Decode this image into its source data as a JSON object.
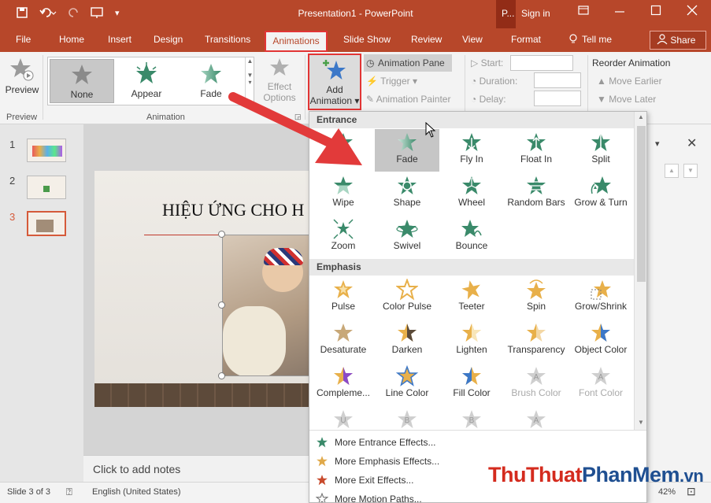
{
  "title_bar": {
    "document_title": "Presentation1 - PowerPoint",
    "context_tab_head": "P...",
    "sign_in": "Sign in",
    "accent_color": "#b7472a"
  },
  "tabs": [
    {
      "label": "File"
    },
    {
      "label": "Home"
    },
    {
      "label": "Insert"
    },
    {
      "label": "Design"
    },
    {
      "label": "Transitions"
    },
    {
      "label": "Animations",
      "active": true
    },
    {
      "label": "Slide Show"
    },
    {
      "label": "Review"
    },
    {
      "label": "View"
    },
    {
      "label": "Format"
    },
    {
      "label": "Tell me"
    }
  ],
  "share_label": "Share",
  "ribbon": {
    "preview": {
      "label": "Preview",
      "group": "Preview"
    },
    "gallery": [
      {
        "label": "None",
        "selected": true
      },
      {
        "label": "Appear"
      },
      {
        "label": "Fade"
      }
    ],
    "effect_options": {
      "line1": "Effect",
      "line2": "Options"
    },
    "animation_group": "Animation",
    "add_animation": {
      "line1": "Add",
      "line2": "Animation"
    },
    "animation_pane": "Animation Pane",
    "trigger": "Trigger",
    "animation_painter": "Animation Painter",
    "start_label": "Start:",
    "duration_label": "Duration:",
    "delay_label": "Delay:",
    "reorder_title": "Reorder Animation",
    "move_earlier": "Move Earlier",
    "move_later": "Move Later"
  },
  "slides": [
    {
      "number": "1"
    },
    {
      "number": "2"
    },
    {
      "number": "3",
      "selected": true
    }
  ],
  "slide": {
    "title": "HIỆU ỨNG CHO H"
  },
  "notes_placeholder": "Click to add notes",
  "dropdown": {
    "entrance": {
      "header": "Entrance",
      "effects": [
        {
          "label": "Appear",
          "shown": "..."
        },
        {
          "label": "Fade",
          "selected": true
        },
        {
          "label": "Fly In"
        },
        {
          "label": "Float In"
        },
        {
          "label": "Split"
        },
        {
          "label": "Wipe"
        },
        {
          "label": "Shape"
        },
        {
          "label": "Wheel"
        },
        {
          "label": "Random Bars"
        },
        {
          "label": "Grow & Turn"
        },
        {
          "label": "Zoom"
        },
        {
          "label": "Swivel"
        },
        {
          "label": "Bounce"
        }
      ]
    },
    "emphasis": {
      "header": "Emphasis",
      "effects": [
        {
          "label": "Pulse"
        },
        {
          "label": "Color Pulse"
        },
        {
          "label": "Teeter"
        },
        {
          "label": "Spin"
        },
        {
          "label": "Grow/Shrink"
        },
        {
          "label": "Desaturate"
        },
        {
          "label": "Darken"
        },
        {
          "label": "Lighten"
        },
        {
          "label": "Transparency"
        },
        {
          "label": "Object Color"
        },
        {
          "label": "Compleme..."
        },
        {
          "label": "Line Color"
        },
        {
          "label": "Fill Color"
        },
        {
          "label": "Brush Color",
          "disabled": true
        },
        {
          "label": "Font Color",
          "disabled": true
        }
      ]
    },
    "more": [
      {
        "label": "More Entrance Effects...",
        "color": "#3a8a6a"
      },
      {
        "label": "More Emphasis Effects...",
        "color": "#e0a94a"
      },
      {
        "label": "More Exit Effects...",
        "color": "#c84a2c"
      },
      {
        "label": "More Motion Paths...",
        "color": "#777777"
      }
    ]
  },
  "status": {
    "slide_info": "Slide 3 of 3",
    "language": "English (United States)",
    "zoom": "42%"
  },
  "watermark": {
    "part1": "ThuThuat",
    "part2": "PhanMem",
    "part3": ".vn"
  }
}
